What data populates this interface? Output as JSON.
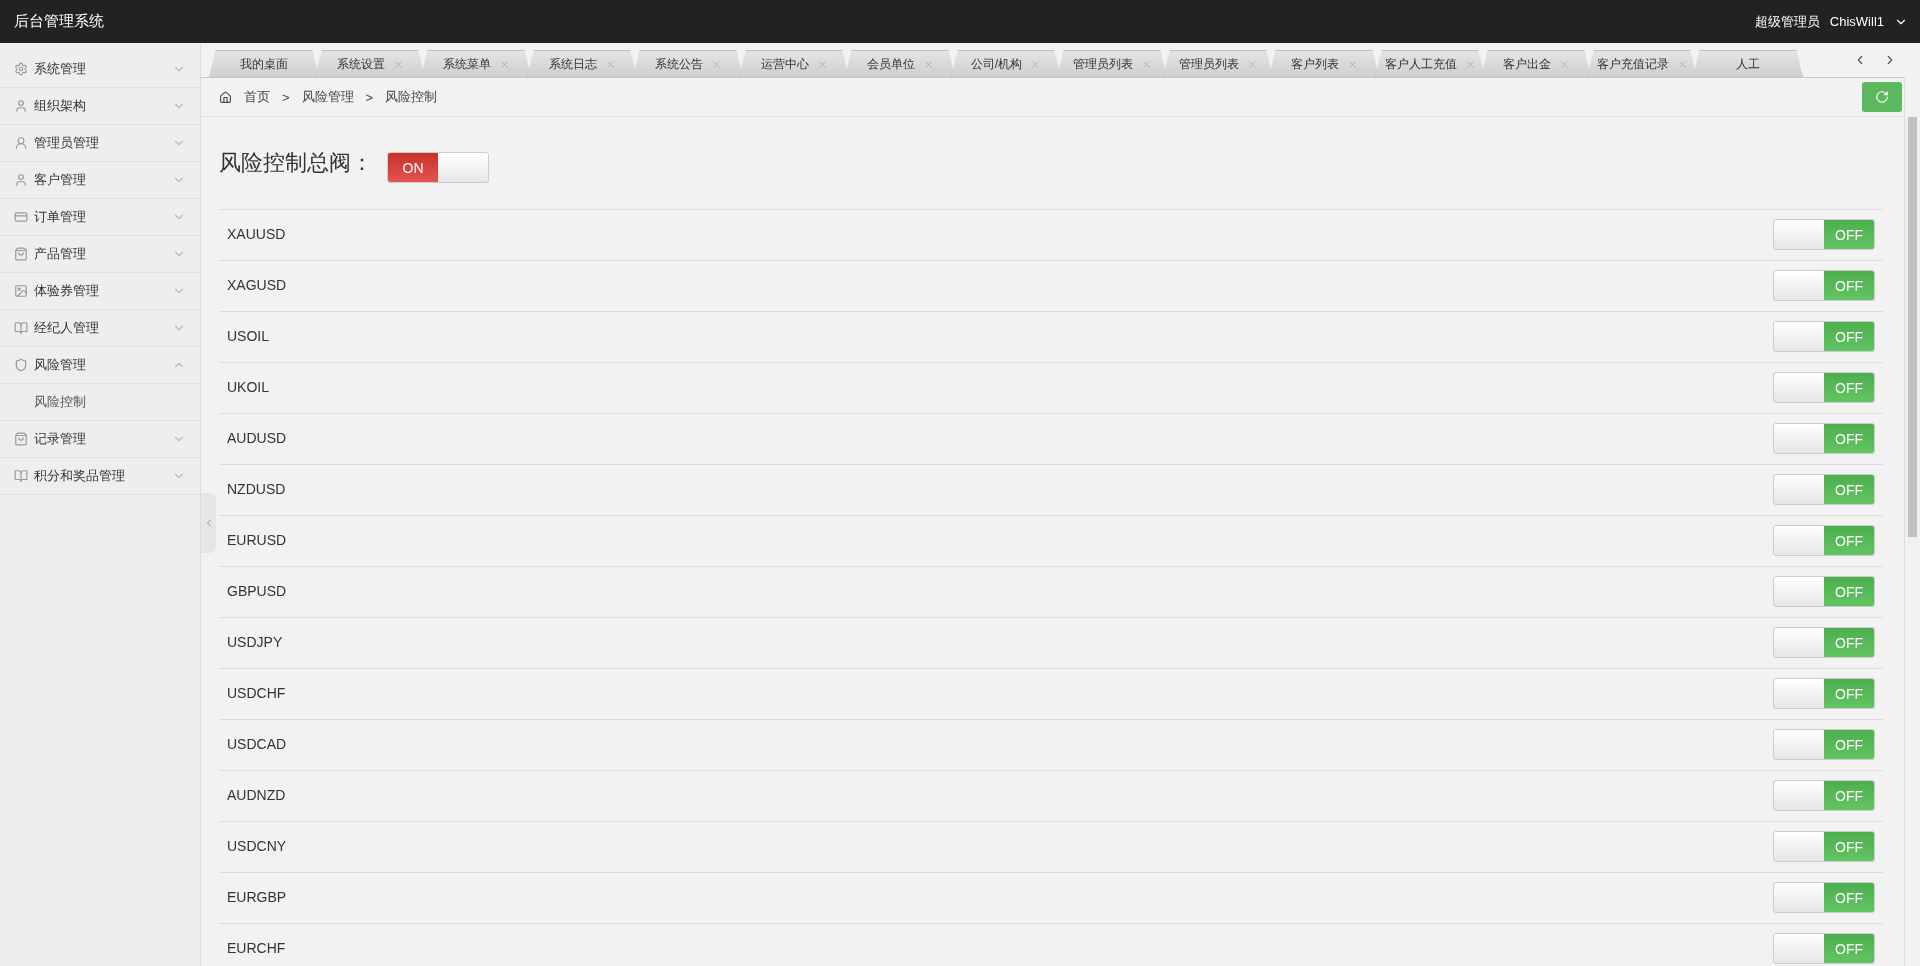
{
  "header": {
    "title": "后台管理系统",
    "role": "超级管理员",
    "user": "ChisWill1"
  },
  "sidebar": {
    "items": [
      {
        "label": "系统管理",
        "expanded": false
      },
      {
        "label": "组织架构",
        "expanded": false
      },
      {
        "label": "管理员管理",
        "expanded": false
      },
      {
        "label": "客户管理",
        "expanded": false
      },
      {
        "label": "订单管理",
        "expanded": false
      },
      {
        "label": "产品管理",
        "expanded": false
      },
      {
        "label": "体验券管理",
        "expanded": false
      },
      {
        "label": "经纪人管理",
        "expanded": false
      },
      {
        "label": "风险管理",
        "expanded": true,
        "children": [
          {
            "label": "风险控制"
          }
        ]
      },
      {
        "label": "记录管理",
        "expanded": false
      },
      {
        "label": "积分和奖品管理",
        "expanded": false
      }
    ]
  },
  "tabs": [
    {
      "label": "我的桌面",
      "closable": false,
      "selected": false
    },
    {
      "label": "系统设置",
      "closable": true,
      "selected": false
    },
    {
      "label": "系统菜单",
      "closable": true,
      "selected": false
    },
    {
      "label": "系统日志",
      "closable": true,
      "selected": false
    },
    {
      "label": "系统公告",
      "closable": true,
      "selected": false
    },
    {
      "label": "运营中心",
      "closable": true,
      "selected": false
    },
    {
      "label": "会员单位",
      "closable": true,
      "selected": false
    },
    {
      "label": "公司/机构",
      "closable": true,
      "selected": false
    },
    {
      "label": "管理员列表",
      "closable": true,
      "selected": false
    },
    {
      "label": "管理员列表",
      "closable": true,
      "selected": false
    },
    {
      "label": "客户列表",
      "closable": true,
      "selected": false
    },
    {
      "label": "客户人工充值",
      "closable": true,
      "selected": false
    },
    {
      "label": "客户出金",
      "closable": true,
      "selected": false
    },
    {
      "label": "客户充值记录",
      "closable": true,
      "selected": false
    },
    {
      "label": "人工",
      "closable": false,
      "selected": false
    }
  ],
  "breadcrumb": [
    "首页",
    "风险管理",
    "风险控制"
  ],
  "breadcrumb_separator": ">",
  "master": {
    "label": "风险控制总阀：",
    "on": true,
    "toggle_label": "ON"
  },
  "rows": [
    {
      "symbol": "XAUUSD",
      "on": false,
      "toggle_label": "OFF"
    },
    {
      "symbol": "XAGUSD",
      "on": false,
      "toggle_label": "OFF"
    },
    {
      "symbol": "USOIL",
      "on": false,
      "toggle_label": "OFF"
    },
    {
      "symbol": "UKOIL",
      "on": false,
      "toggle_label": "OFF"
    },
    {
      "symbol": "AUDUSD",
      "on": false,
      "toggle_label": "OFF"
    },
    {
      "symbol": "NZDUSD",
      "on": false,
      "toggle_label": "OFF"
    },
    {
      "symbol": "EURUSD",
      "on": false,
      "toggle_label": "OFF"
    },
    {
      "symbol": "GBPUSD",
      "on": false,
      "toggle_label": "OFF"
    },
    {
      "symbol": "USDJPY",
      "on": false,
      "toggle_label": "OFF"
    },
    {
      "symbol": "USDCHF",
      "on": false,
      "toggle_label": "OFF"
    },
    {
      "symbol": "USDCAD",
      "on": false,
      "toggle_label": "OFF"
    },
    {
      "symbol": "AUDNZD",
      "on": false,
      "toggle_label": "OFF"
    },
    {
      "symbol": "USDCNY",
      "on": false,
      "toggle_label": "OFF"
    },
    {
      "symbol": "EURGBP",
      "on": false,
      "toggle_label": "OFF"
    },
    {
      "symbol": "EURCHF",
      "on": false,
      "toggle_label": "OFF"
    }
  ]
}
